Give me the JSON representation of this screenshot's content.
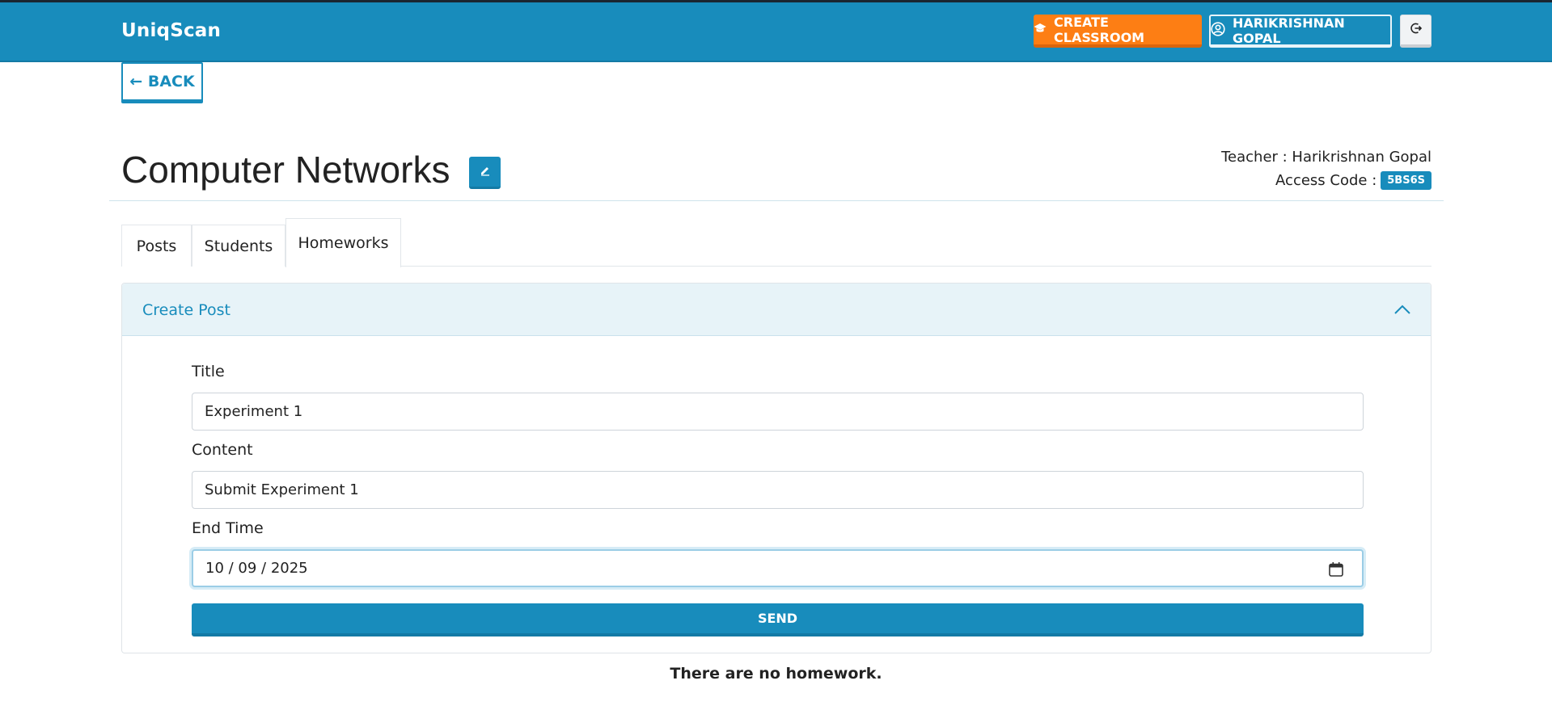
{
  "app": {
    "brand": "UniqScan"
  },
  "header": {
    "create_classroom_label": "CREATE CLASSROOM",
    "user_label": "HARIKRISHNAN GOPAL"
  },
  "nav": {
    "back_label": "← BACK"
  },
  "classroom": {
    "title": "Computer Networks",
    "teacher": "Teacher : Harikrishnan Gopal",
    "access_code_label": "Access Code :",
    "access_code": "5BS6S"
  },
  "tabs": [
    {
      "label": "Posts",
      "active": false
    },
    {
      "label": "Students",
      "active": false
    },
    {
      "label": "Homeworks",
      "active": true
    }
  ],
  "create_post": {
    "header": "Create Post",
    "title_label": "Title",
    "title_value": "Experiment 1",
    "content_label": "Content",
    "content_value": "Submit Experiment 1",
    "end_time_label": "End Time",
    "end_time_value": "10 / 09 / 2025",
    "send_label": "SEND"
  },
  "empty_message": "There are no homework.",
  "colors": {
    "primary": "#188cbc",
    "accent": "#fd7e14",
    "navbar_border": "#1a2530"
  },
  "icons": [
    "graduation-cap-icon",
    "user-circle-icon",
    "logout-icon",
    "pencil-icon",
    "chevron-up-icon",
    "calendar-icon"
  ]
}
